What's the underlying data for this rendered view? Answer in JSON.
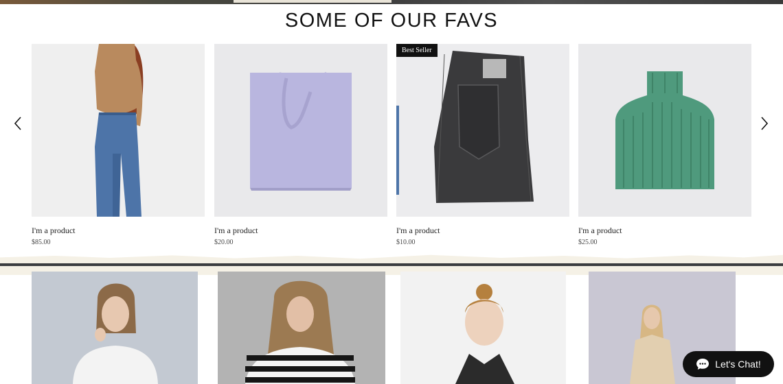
{
  "section": {
    "title": "SOME OF OUR FAVS"
  },
  "products": [
    {
      "name": "I'm a product",
      "price": "$85.00",
      "image": "model-jeans-tan-tee"
    },
    {
      "name": "I'm a product",
      "price": "$20.00",
      "image": "lavender-tote-bag"
    },
    {
      "name": "I'm a product",
      "price": "$10.00",
      "image": "folded-black-jeans",
      "badge": "Best Seller"
    },
    {
      "name": "I'm a product",
      "price": "$25.00",
      "image": "green-knit-turtleneck"
    }
  ],
  "carousel": {
    "prev_icon": "chevron-left-icon",
    "next_icon": "chevron-right-icon"
  },
  "gallery": [
    {
      "image": "model-white-knit-sweater"
    },
    {
      "image": "model-striped-top"
    },
    {
      "image": "model-dark-jacket-bun"
    },
    {
      "image": "model-beige-top"
    }
  ],
  "chat": {
    "label": "Let's Chat!",
    "icon": "chat-bubble-icon"
  },
  "colors": {
    "text": "#111111",
    "badge_bg": "#111111",
    "divider_bar": "#3b3d40",
    "divider_bg": "#f5f1e6",
    "chat_bg": "#111111"
  }
}
